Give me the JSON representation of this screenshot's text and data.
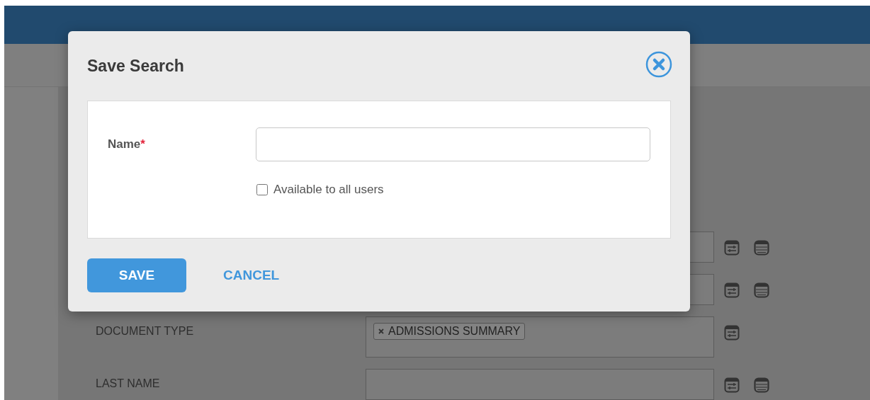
{
  "background_form": {
    "rows": [
      {
        "has_table_button": true
      },
      {
        "has_table_button": true
      },
      {
        "label": "DOCUMENT TYPE",
        "tags": [
          "ADMISSIONS SUMMARY"
        ],
        "has_table_button": false
      },
      {
        "label": "LAST NAME",
        "has_table_button": true
      }
    ]
  },
  "dialog": {
    "title": "Save Search",
    "field": {
      "label": "Name",
      "required_mark": "*"
    },
    "checkbox": {
      "label": "Available to all users",
      "checked": false
    },
    "buttons": [
      {
        "label": "SAVE",
        "kind": "primary"
      },
      {
        "label": "CANCEL",
        "kind": "link"
      }
    ]
  }
}
